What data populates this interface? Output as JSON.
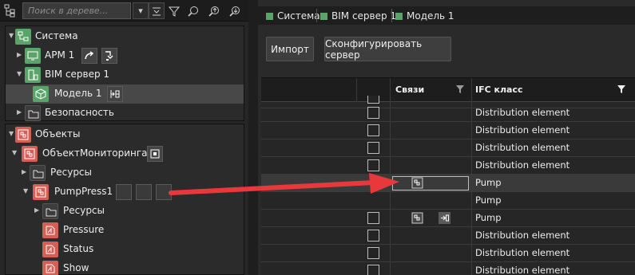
{
  "left_toolbar": {
    "search_placeholder": "Поиск в дереве..."
  },
  "system_tree": {
    "root": "Система",
    "items": [
      "АРМ 1",
      "BIM сервер 1",
      "Модель 1",
      "Безопасность"
    ]
  },
  "objects_tree": {
    "root": "Объекты",
    "items": [
      "ОбъектМониторинга",
      "Ресурсы",
      "PumpPress1",
      "Ресурсы",
      "Pressure",
      "Status",
      "Show"
    ]
  },
  "tabs": [
    "Система",
    "BIM сервер 1",
    "Модель 1"
  ],
  "buttons": {
    "import": "Импорт",
    "configure": "Сконфигурировать сервер"
  },
  "grid": {
    "headers": {
      "links": "Связи",
      "ifc_class": "IFC класс"
    },
    "rows": [
      {
        "ifc": "",
        "link": ""
      },
      {
        "ifc": "Distribution element",
        "link": ""
      },
      {
        "ifc": "Distribution element",
        "link": ""
      },
      {
        "ifc": "Distribution element",
        "link": ""
      },
      {
        "ifc": "Distribution element",
        "link": ""
      },
      {
        "ifc": "Pump",
        "link": "linked-object-icon"
      },
      {
        "ifc": "Pump",
        "link": ""
      },
      {
        "ifc": "Pump",
        "link": "linked-object-icon"
      },
      {
        "ifc": "Distribution element",
        "link": ""
      },
      {
        "ifc": "Distribution element",
        "link": ""
      },
      {
        "ifc": "Distribution element",
        "link": ""
      }
    ]
  },
  "colors": {
    "system_green": "#5aa469",
    "object_red": "#d45f54",
    "arrow_red": "#e8383b"
  }
}
